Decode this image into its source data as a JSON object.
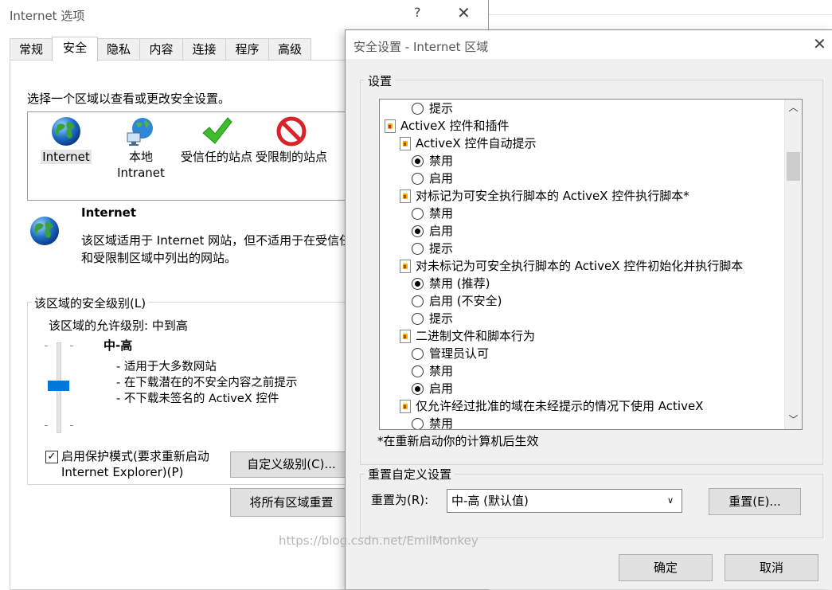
{
  "back_window": {
    "title": "Internet 选项",
    "help_glyph": "?",
    "close_glyph": "✕",
    "tabs": [
      "常规",
      "安全",
      "隐私",
      "内容",
      "连接",
      "程序",
      "高级"
    ],
    "active_tab": "安全",
    "zone_prompt": "选择一个区域以查看或更改安全设置。",
    "zones": [
      {
        "label": "Internet",
        "icon": "globe-icon"
      },
      {
        "label": "本地\nIntranet",
        "icon": "intranet-icon"
      },
      {
        "label": "受信任的站点",
        "icon": "checkmark-icon"
      },
      {
        "label": "受限制的站点",
        "icon": "restricted-icon"
      }
    ],
    "zone_title": "Internet",
    "zone_desc_line1": "该区域适用于 Internet 网站，但不适用于在受信任",
    "zone_desc_line2": "和受限制区域中列出的网站。",
    "security_level_legend": "该区域的安全级别(L)",
    "allowed_level": "该区域的允许级别: 中到高",
    "level_name": "中-高",
    "level_desc": [
      "- 适用于大多数网站",
      "- 在下载潜在的不安全内容之前提示",
      "- 不下载未签名的 ActiveX 控件"
    ],
    "protected_mode_checked": "✓",
    "protected_mode_line1": "启用保护模式(要求重新启动",
    "protected_mode_line2": "Internet Explorer)(P)",
    "custom_level_button": "自定义级别(C)...",
    "reset_all_button": "将所有区域重置"
  },
  "front_window": {
    "title": "安全设置 - Internet 区域",
    "close_glyph": "✕",
    "settings_legend": "设置",
    "tree_rows": [
      {
        "kind": "radio",
        "indent": 2,
        "label": "提示",
        "checked": false
      },
      {
        "kind": "category",
        "indent": 0,
        "label": "ActiveX 控件和插件"
      },
      {
        "kind": "setting",
        "indent": 1,
        "label": "ActiveX 控件自动提示"
      },
      {
        "kind": "radio",
        "indent": 2,
        "label": "禁用",
        "checked": true
      },
      {
        "kind": "radio",
        "indent": 2,
        "label": "启用",
        "checked": false
      },
      {
        "kind": "setting",
        "indent": 1,
        "label": "对标记为可安全执行脚本的 ActiveX 控件执行脚本*"
      },
      {
        "kind": "radio",
        "indent": 2,
        "label": "禁用",
        "checked": false
      },
      {
        "kind": "radio",
        "indent": 2,
        "label": "启用",
        "checked": true
      },
      {
        "kind": "radio",
        "indent": 2,
        "label": "提示",
        "checked": false
      },
      {
        "kind": "setting",
        "indent": 1,
        "label": "对未标记为可安全执行脚本的 ActiveX 控件初始化并执行脚本"
      },
      {
        "kind": "radio",
        "indent": 2,
        "label": "禁用 (推荐)",
        "checked": true
      },
      {
        "kind": "radio",
        "indent": 2,
        "label": "启用 (不安全)",
        "checked": false
      },
      {
        "kind": "radio",
        "indent": 2,
        "label": "提示",
        "checked": false
      },
      {
        "kind": "setting",
        "indent": 1,
        "label": "二进制文件和脚本行为"
      },
      {
        "kind": "radio",
        "indent": 2,
        "label": "管理员认可",
        "checked": false
      },
      {
        "kind": "radio",
        "indent": 2,
        "label": "禁用",
        "checked": false
      },
      {
        "kind": "radio",
        "indent": 2,
        "label": "启用",
        "checked": true
      },
      {
        "kind": "setting",
        "indent": 1,
        "label": "仅允许经过批准的域在未经提示的情况下使用 ActiveX"
      },
      {
        "kind": "radio",
        "indent": 2,
        "label": "禁用",
        "checked": false
      }
    ],
    "scroll_up_glyph": "︿",
    "scroll_down_glyph": "﹀",
    "restart_note": "*在重新启动你的计算机后生效",
    "reset_legend": "重置自定义设置",
    "reset_to_label": "重置为(R):",
    "reset_to_value": "中-高 (默认值)",
    "select_arrow_glyph": "∨",
    "reset_button": "重置(E)...",
    "ok_button": "确定",
    "cancel_button": "取消"
  },
  "watermark": "https://blog.csdn.net/EmilMonkey"
}
